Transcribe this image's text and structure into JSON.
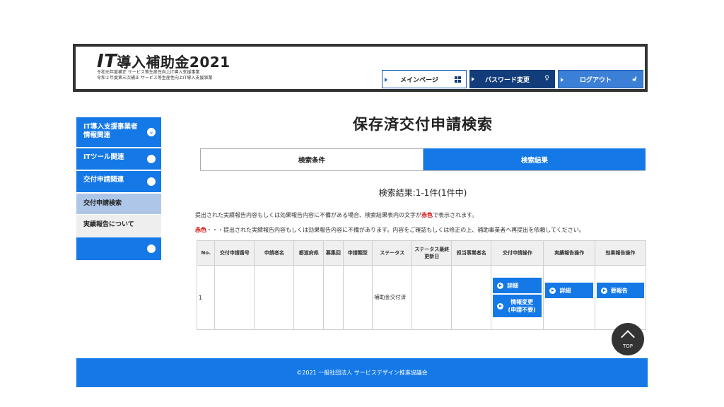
{
  "header": {
    "logo_it": "IT",
    "logo_rest": "導入補助金2021",
    "logo_sub1": "令和元年度補正 サービス等生産性向上IT導入支援事業",
    "logo_sub2": "令和２年度第三次補正 サービス等生産性向上IT導入支援事業",
    "nav_main": "メインページ",
    "nav_password": "パスワード変更",
    "nav_logout": "ログアウト"
  },
  "sidebar": {
    "items": [
      {
        "label": "IT導入支援事業者情報関連"
      },
      {
        "label": "ITツール関連"
      },
      {
        "label": "交付申請関連"
      }
    ],
    "sub_active": "交付申請検索",
    "sub_other": "実績報告について"
  },
  "main": {
    "title": "保存済交付申請検索",
    "tab_conditions": "検索条件",
    "tab_results": "検索結果",
    "result_count": "検索結果:1-1件(1件中)",
    "note1_pre": "提出された実績報告内容もしくは効果報告内容に不備がある場合、検索結果表内の文字が",
    "note1_red": "赤色",
    "note1_post": "で表示されます。",
    "note2_red": "赤色",
    "note2_post": "・・・提出された実績報告内容もしくは効果報告内容に不備があります。内容をご確認もしくは修正の上、補助事業者へ再提出を依頼してください。"
  },
  "table": {
    "headers": [
      "No.",
      "交付申請番号",
      "申請者名",
      "都道府県",
      "募集回",
      "申請類型",
      "ステータス",
      "ステータス最終更新日",
      "担当事業者名",
      "交付申請操作",
      "実績報告操作",
      "効果報告操作"
    ],
    "row": {
      "no": "1",
      "status": "補助金交付済",
      "btn_detail": "詳細",
      "btn_change": "情報変更(申請不要)",
      "btn_jisseki_detail": "詳細",
      "btn_report": "要報告"
    }
  },
  "top_label": "TOP",
  "footer": {
    "text": "©2021 一般社団法人 サービスデザイン推進協議会"
  }
}
